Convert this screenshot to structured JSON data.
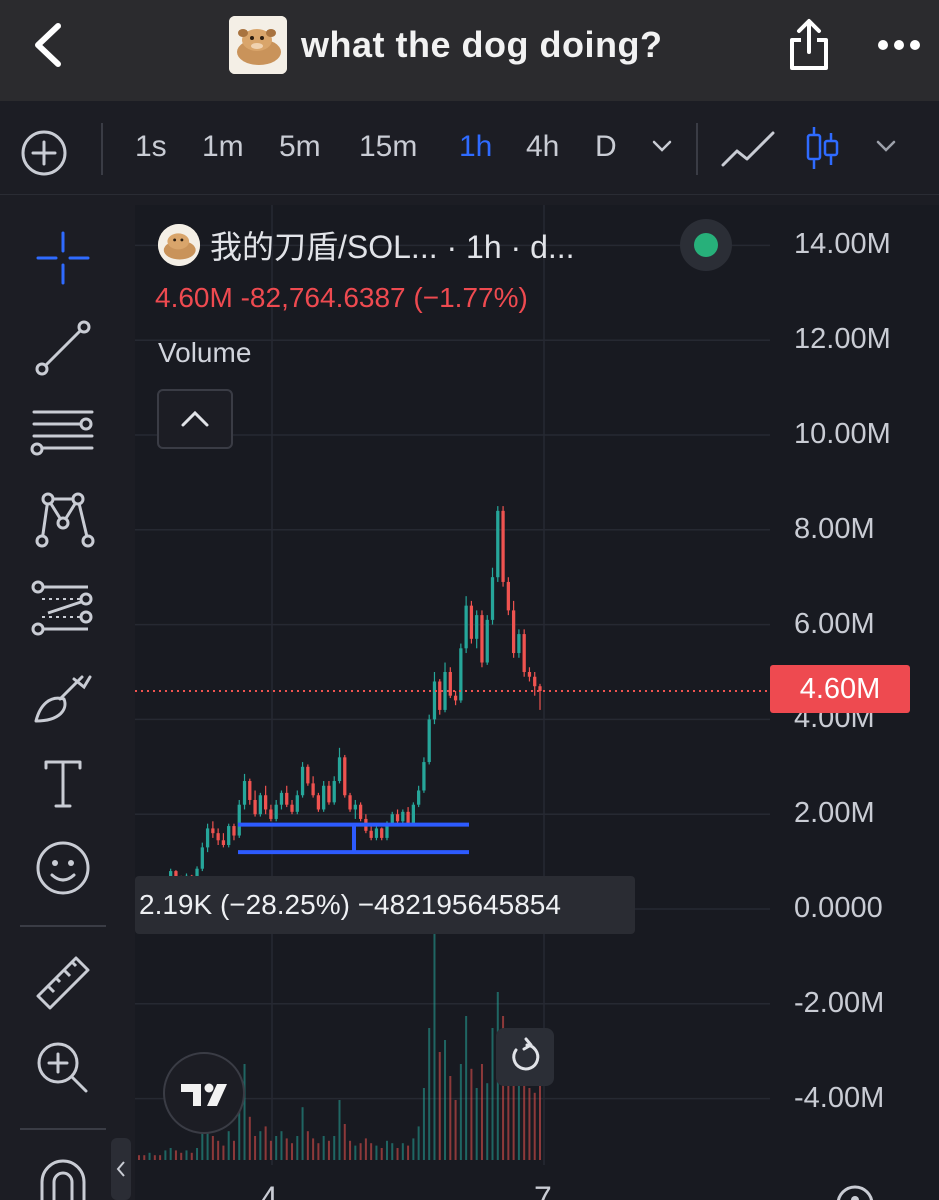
{
  "header": {
    "title": "what the dog doing?",
    "avatar_icon": "dog-avatar-icon"
  },
  "timeframes": {
    "items": [
      "1s",
      "1m",
      "5m",
      "15m",
      "1h",
      "4h",
      "D"
    ],
    "active": "1h"
  },
  "chart_header": {
    "symbol": "我的刀盾/SOL...  · 1h · d...",
    "ohlc": "4.60M  -82,764.6387 (−1.77%)",
    "volume_label": "Volume",
    "status_color": "#27b07a"
  },
  "crosshair_tooltip": "2.19K (−28.25%) −482195645854",
  "price_badge": "4.60M",
  "colors": {
    "up": "#26a69a",
    "down": "#ef5350",
    "accent": "#2f6bff",
    "drawing": "#2d5bff",
    "last_price_line": "#ef5350"
  },
  "chart_data": {
    "type": "candlestick",
    "interval": "1h",
    "y_axis_labels": [
      "14.00M",
      "12.00M",
      "10.00M",
      "8.00M",
      "6.00M",
      "4.00M",
      "2.00M",
      "0.0000",
      "-2.00M",
      "-4.00M"
    ],
    "x_axis_labels": [
      "4",
      "7"
    ],
    "last_price": 4.6,
    "last_price_label": "4.60M",
    "unit": "M",
    "candles": [
      [
        0.45,
        0.5,
        0.35,
        0.42
      ],
      [
        0.42,
        0.44,
        0.32,
        0.36
      ],
      [
        0.36,
        0.48,
        0.34,
        0.46
      ],
      [
        0.46,
        0.5,
        0.38,
        0.4
      ],
      [
        0.4,
        0.43,
        0.33,
        0.35
      ],
      [
        0.35,
        0.6,
        0.34,
        0.58
      ],
      [
        0.58,
        0.85,
        0.55,
        0.8
      ],
      [
        0.8,
        0.82,
        0.6,
        0.65
      ],
      [
        0.65,
        0.7,
        0.55,
        0.6
      ],
      [
        0.6,
        0.75,
        0.58,
        0.7
      ],
      [
        0.7,
        0.72,
        0.55,
        0.6
      ],
      [
        0.6,
        0.9,
        0.58,
        0.85
      ],
      [
        0.85,
        1.4,
        0.8,
        1.3
      ],
      [
        1.3,
        1.8,
        1.2,
        1.7
      ],
      [
        1.7,
        1.85,
        1.5,
        1.6
      ],
      [
        1.6,
        1.7,
        1.35,
        1.45
      ],
      [
        1.45,
        1.6,
        1.3,
        1.35
      ],
      [
        1.35,
        1.8,
        1.3,
        1.75
      ],
      [
        1.75,
        1.8,
        1.45,
        1.55
      ],
      [
        1.55,
        2.3,
        1.5,
        2.2
      ],
      [
        2.2,
        2.85,
        2.1,
        2.7
      ],
      [
        2.7,
        2.75,
        2.2,
        2.3
      ],
      [
        2.3,
        2.5,
        1.95,
        2.0
      ],
      [
        2.0,
        2.45,
        1.95,
        2.4
      ],
      [
        2.4,
        2.6,
        2.0,
        2.1
      ],
      [
        2.1,
        2.2,
        1.85,
        1.9
      ],
      [
        1.9,
        2.3,
        1.85,
        2.2
      ],
      [
        2.2,
        2.5,
        2.1,
        2.45
      ],
      [
        2.45,
        2.6,
        2.15,
        2.2
      ],
      [
        2.2,
        2.3,
        2.0,
        2.05
      ],
      [
        2.05,
        2.5,
        2.0,
        2.4
      ],
      [
        2.4,
        3.1,
        2.35,
        3.0
      ],
      [
        3.0,
        3.05,
        2.6,
        2.65
      ],
      [
        2.65,
        2.8,
        2.35,
        2.4
      ],
      [
        2.4,
        2.45,
        2.05,
        2.1
      ],
      [
        2.1,
        2.7,
        2.05,
        2.6
      ],
      [
        2.6,
        2.7,
        2.2,
        2.25
      ],
      [
        2.25,
        2.8,
        2.2,
        2.7
      ],
      [
        2.7,
        3.4,
        2.65,
        3.2
      ],
      [
        3.2,
        3.25,
        2.35,
        2.4
      ],
      [
        2.4,
        2.45,
        2.05,
        2.1
      ],
      [
        2.1,
        2.3,
        1.9,
        2.2
      ],
      [
        2.2,
        2.25,
        1.85,
        1.9
      ],
      [
        1.9,
        2.0,
        1.6,
        1.65
      ],
      [
        1.65,
        1.8,
        1.45,
        1.5
      ],
      [
        1.5,
        1.75,
        1.45,
        1.7
      ],
      [
        1.7,
        1.72,
        1.45,
        1.5
      ],
      [
        1.5,
        1.85,
        1.45,
        1.8
      ],
      [
        1.8,
        2.05,
        1.75,
        2.0
      ],
      [
        2.0,
        2.1,
        1.8,
        1.85
      ],
      [
        1.85,
        2.1,
        1.8,
        2.05
      ],
      [
        2.05,
        2.15,
        1.75,
        1.8
      ],
      [
        1.8,
        2.25,
        1.75,
        2.2
      ],
      [
        2.2,
        2.6,
        2.15,
        2.5
      ],
      [
        2.5,
        3.2,
        2.45,
        3.1
      ],
      [
        3.1,
        4.1,
        3.05,
        4.0
      ],
      [
        4.0,
        5.0,
        3.9,
        4.8
      ],
      [
        4.8,
        4.85,
        4.1,
        4.2
      ],
      [
        4.2,
        5.2,
        4.15,
        5.0
      ],
      [
        5.0,
        5.1,
        4.45,
        4.5
      ],
      [
        4.5,
        4.6,
        4.3,
        4.4
      ],
      [
        4.4,
        5.6,
        4.35,
        5.5
      ],
      [
        5.5,
        6.6,
        5.4,
        6.4
      ],
      [
        6.4,
        6.5,
        5.6,
        5.7
      ],
      [
        5.7,
        6.3,
        5.5,
        6.2
      ],
      [
        6.2,
        6.3,
        5.1,
        5.2
      ],
      [
        5.2,
        6.2,
        5.15,
        6.1
      ],
      [
        6.1,
        7.2,
        6.0,
        7.0
      ],
      [
        7.0,
        8.5,
        6.9,
        8.4
      ],
      [
        8.4,
        8.5,
        6.8,
        6.9
      ],
      [
        6.9,
        7.0,
        6.2,
        6.3
      ],
      [
        6.3,
        6.5,
        5.3,
        5.4
      ],
      [
        5.4,
        5.9,
        5.3,
        5.8
      ],
      [
        5.8,
        5.9,
        4.9,
        5.0
      ],
      [
        5.0,
        5.1,
        4.8,
        4.9
      ],
      [
        4.9,
        5.0,
        4.5,
        4.7
      ],
      [
        4.7,
        4.75,
        4.2,
        4.6
      ]
    ],
    "volume_relative": [
      0.02,
      0.02,
      0.03,
      0.02,
      0.02,
      0.04,
      0.05,
      0.04,
      0.03,
      0.04,
      0.03,
      0.05,
      0.12,
      0.22,
      0.1,
      0.08,
      0.06,
      0.12,
      0.08,
      0.2,
      0.4,
      0.18,
      0.1,
      0.12,
      0.14,
      0.08,
      0.1,
      0.12,
      0.09,
      0.07,
      0.1,
      0.22,
      0.12,
      0.09,
      0.07,
      0.1,
      0.08,
      0.1,
      0.25,
      0.15,
      0.08,
      0.06,
      0.07,
      0.09,
      0.07,
      0.06,
      0.05,
      0.08,
      0.07,
      0.05,
      0.07,
      0.06,
      0.09,
      0.14,
      0.3,
      0.55,
      1.0,
      0.45,
      0.5,
      0.35,
      0.25,
      0.4,
      0.6,
      0.38,
      0.3,
      0.4,
      0.32,
      0.55,
      0.7,
      0.6,
      0.45,
      0.55,
      0.35,
      0.5,
      0.3,
      0.28,
      0.35
    ],
    "range_drawing": {
      "top_value": 1.78,
      "bottom_value": 1.2
    }
  }
}
